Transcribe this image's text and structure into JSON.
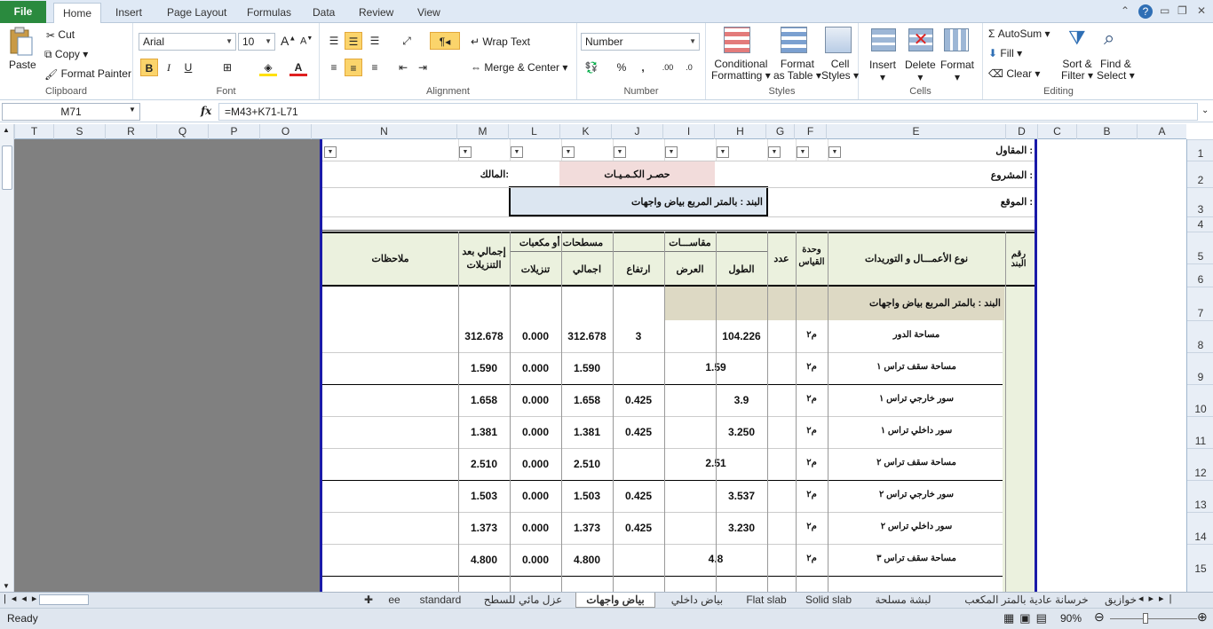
{
  "ribbon_tabs": [
    "File",
    "Home",
    "Insert",
    "Page Layout",
    "Formulas",
    "Data",
    "Review",
    "View"
  ],
  "clipboard": {
    "paste": "Paste",
    "cut": "Cut",
    "copy": "Copy",
    "format_painter": "Format Painter",
    "label": "Clipboard"
  },
  "font": {
    "name": "Arial",
    "size": "10",
    "label": "Font",
    "bold": "B",
    "italic": "I",
    "underline": "U"
  },
  "alignment": {
    "wrap": "Wrap Text",
    "merge": "Merge & Center",
    "label": "Alignment"
  },
  "number": {
    "format": "Number",
    "label": "Number",
    "percent": "%",
    "comma": ","
  },
  "styles": {
    "conditional": "Conditional",
    "formatting": "Formatting",
    "format_as": "Format",
    "as_table": "as Table",
    "cell": "Cell",
    "cell_styles": "Styles",
    "label": "Styles"
  },
  "cells": {
    "insert": "Insert",
    "delete": "Delete",
    "format": "Format",
    "label": "Cells"
  },
  "editing": {
    "autosum": "AutoSum",
    "fill": "Fill",
    "clear": "Clear",
    "sort": "Sort &",
    "filter": "Filter",
    "find": "Find &",
    "select": "Select",
    "label": "Editing"
  },
  "name_box": "M71",
  "fx": "fx",
  "formula": "=M43+K71-L71",
  "columns": [
    "T",
    "S",
    "R",
    "Q",
    "P",
    "O",
    "N",
    "M",
    "L",
    "K",
    "J",
    "I",
    "H",
    "G",
    "F",
    "E",
    "D",
    "C",
    "B",
    "A"
  ],
  "rows": [
    "1",
    "2",
    "3",
    "4",
    "5",
    "6",
    "7",
    "8",
    "9",
    "10",
    "11",
    "12",
    "13",
    "14",
    "15"
  ],
  "sheet": {
    "contractor": "المقاول :",
    "project": "المشروع :",
    "location": "الموقع :",
    "owner": "المالك:",
    "title": "حصـر الكـمـيـات",
    "item_box": "البند : بالمتر المربع بياض واجهات",
    "headers": {
      "item_no": "رقم البند",
      "work_type": "نوع الأعمـــال و التوريدات",
      "unit": "وحدة القياس",
      "count": "عدد",
      "dimensions": "مقاســـات",
      "length": "الطول",
      "width": "العرض",
      "height": "ارتفاع",
      "areas": "مسطحات أو مكعبات",
      "total": "اجمالي",
      "deductions": "تنزيلات",
      "net": "إجمالي بعد التنزيلات",
      "notes": "ملاحظات"
    },
    "section_title": "البند : بالمتر المربع بياض واجهات",
    "rows": [
      {
        "desc": "مساحة الدور",
        "unit": "م٢",
        "length": "104.226",
        "width": "",
        "height": "3",
        "total": "312.678",
        "deduct": "0.000",
        "net": "312.678"
      },
      {
        "desc": "مساحة سقف تراس ١",
        "unit": "م٢",
        "merged": "1.59",
        "height": "",
        "total": "1.590",
        "deduct": "0.000",
        "net": "1.590"
      },
      {
        "desc": "سور خارجي تراس ١",
        "unit": "م٢",
        "length": "3.9",
        "width": "",
        "height": "0.425",
        "total": "1.658",
        "deduct": "0.000",
        "net": "1.658"
      },
      {
        "desc": "سور داخلي تراس ١",
        "unit": "م٢",
        "length": "3.250",
        "width": "",
        "height": "0.425",
        "total": "1.381",
        "deduct": "0.000",
        "net": "1.381"
      },
      {
        "desc": "مساحة سقف تراس ٢",
        "unit": "م٢",
        "merged": "2.51",
        "height": "",
        "total": "2.510",
        "deduct": "0.000",
        "net": "2.510"
      },
      {
        "desc": "سور خارجي تراس ٢",
        "unit": "م٢",
        "length": "3.537",
        "width": "",
        "height": "0.425",
        "total": "1.503",
        "deduct": "0.000",
        "net": "1.503"
      },
      {
        "desc": "سور داخلي تراس ٢",
        "unit": "م٢",
        "length": "3.230",
        "width": "",
        "height": "0.425",
        "total": "1.373",
        "deduct": "0.000",
        "net": "1.373"
      },
      {
        "desc": "مساحة سقف تراس ٣",
        "unit": "م٢",
        "merged": "4.8",
        "height": "",
        "total": "4.800",
        "deduct": "0.000",
        "net": "4.800"
      }
    ]
  },
  "sheet_tabs": [
    "خوازيق",
    "خرسانة عادية بالمتر المكعب",
    "لبشة مسلحة",
    "Solid slab",
    "Flat slab",
    "بياض داخلي",
    "بياض واجهات",
    "عزل مائي للسطح",
    "standard",
    "ee"
  ],
  "status": {
    "ready": "Ready",
    "zoom": "90%"
  }
}
